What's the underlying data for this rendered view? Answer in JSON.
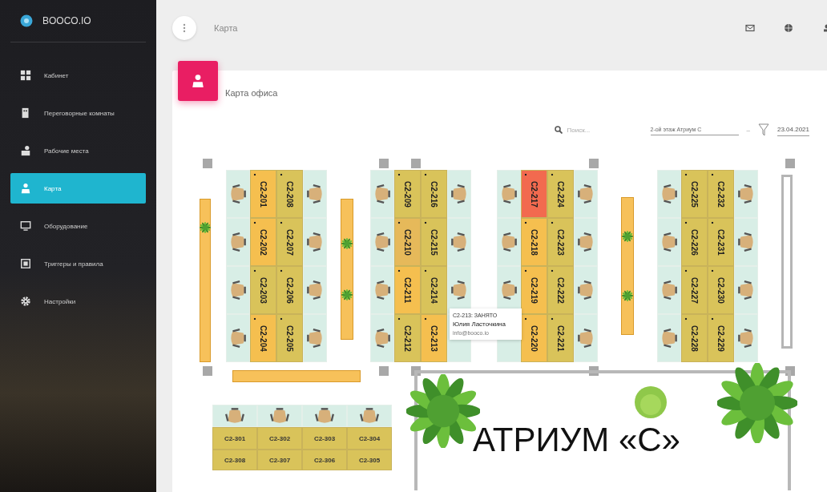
{
  "sidebar": {
    "logo": "BOOCO.IO",
    "items": [
      {
        "label": "Кабинет",
        "selected": false
      },
      {
        "label": "Переговорные комнаты",
        "selected": false
      },
      {
        "label": "Рабочие места",
        "selected": false
      },
      {
        "label": "Карта",
        "selected": true
      },
      {
        "label": "Оборудование",
        "selected": false
      },
      {
        "label": "Триггеры и правила",
        "selected": false
      },
      {
        "label": "Настройки",
        "selected": false
      }
    ]
  },
  "topbar": {
    "title": "Карта"
  },
  "card": {
    "title": "Карта офиса",
    "search": {
      "placeholder": "Поиск..."
    },
    "floor": "2-ой этаж Атриум С",
    "separator": "–",
    "date": "23.04.2021"
  },
  "map": {
    "blocks": [
      {
        "left": [
          {
            "label": "C2-201",
            "color": "#f5bf4f",
            "chair": true
          },
          {
            "label": "C2-202",
            "color": "#f5bf4f",
            "chair": true
          },
          {
            "label": "C2-203",
            "color": "#d9c35a",
            "chair": true
          },
          {
            "label": "C2-204",
            "color": "#f5bf4f",
            "chair": true
          }
        ],
        "right": [
          {
            "label": "C2-208",
            "color": "#d9c35a",
            "chair": true
          },
          {
            "label": "C2-207",
            "color": "#d9c35a",
            "chair": true
          },
          {
            "label": "C2-206",
            "color": "#d9c35a",
            "chair": true
          },
          {
            "label": "C2-205",
            "color": "#d9c35a",
            "chair": true
          }
        ]
      },
      {
        "left": [
          {
            "label": "C2-209",
            "color": "#d9c35a",
            "chair": true
          },
          {
            "label": "C2-210",
            "color": "#e6b95a",
            "chair": true
          },
          {
            "label": "C2-211",
            "color": "#f5bf4f",
            "chair": true
          },
          {
            "label": "C2-212",
            "color": "#d9c35a",
            "chair": true
          }
        ],
        "right": [
          {
            "label": "C2-216",
            "color": "#d9c35a",
            "chair": true
          },
          {
            "label": "C2-215",
            "color": "#d9c35a",
            "chair": true
          },
          {
            "label": "C2-214",
            "color": "#d9c35a",
            "chair": true
          },
          {
            "label": "C2-213",
            "color": "#f5bf4f",
            "chair": false
          }
        ]
      },
      {
        "left": [
          {
            "label": "C2-217",
            "color": "#f26a4f",
            "chair": true
          },
          {
            "label": "C2-218",
            "color": "#f5bf4f",
            "chair": true
          },
          {
            "label": "C2-219",
            "color": "#f5bf4f",
            "chair": true
          },
          {
            "label": "C2-220",
            "color": "#f5bf4f",
            "chair": false
          }
        ],
        "right": [
          {
            "label": "C2-224",
            "color": "#d9c35a",
            "chair": true
          },
          {
            "label": "C2-223",
            "color": "#d9c35a",
            "chair": true
          },
          {
            "label": "C2-222",
            "color": "#d9c35a",
            "chair": true
          },
          {
            "label": "C2-221",
            "color": "#d9c35a",
            "chair": true
          }
        ]
      },
      {
        "left": [
          {
            "label": "C2-225",
            "color": "#d9c35a",
            "chair": true
          },
          {
            "label": "C2-226",
            "color": "#d9c35a",
            "chair": true
          },
          {
            "label": "C2-227",
            "color": "#d9c35a",
            "chair": true
          },
          {
            "label": "C2-228",
            "color": "#d9c35a",
            "chair": true
          }
        ],
        "right": [
          {
            "label": "C2-232",
            "color": "#d9c35a",
            "chair": true
          },
          {
            "label": "C2-231",
            "color": "#d9c35a",
            "chair": true
          },
          {
            "label": "C2-230",
            "color": "#d9c35a",
            "chair": true
          },
          {
            "label": "C2-229",
            "color": "#d9c35a",
            "chair": true
          }
        ]
      }
    ],
    "stools": {
      "row_1": [
        "C2-301",
        "C2-302",
        "C2-303",
        "C2-304"
      ],
      "row_2": [
        "C2-308",
        "C2-307",
        "C2-306",
        "C2-305"
      ]
    },
    "tooltip": {
      "title": "C2-213: ЗАНЯТО",
      "name": "Юлия Ласточкина",
      "email": "info@booco.io"
    },
    "atrium": {
      "label": "АТРИУМ «С»"
    }
  }
}
